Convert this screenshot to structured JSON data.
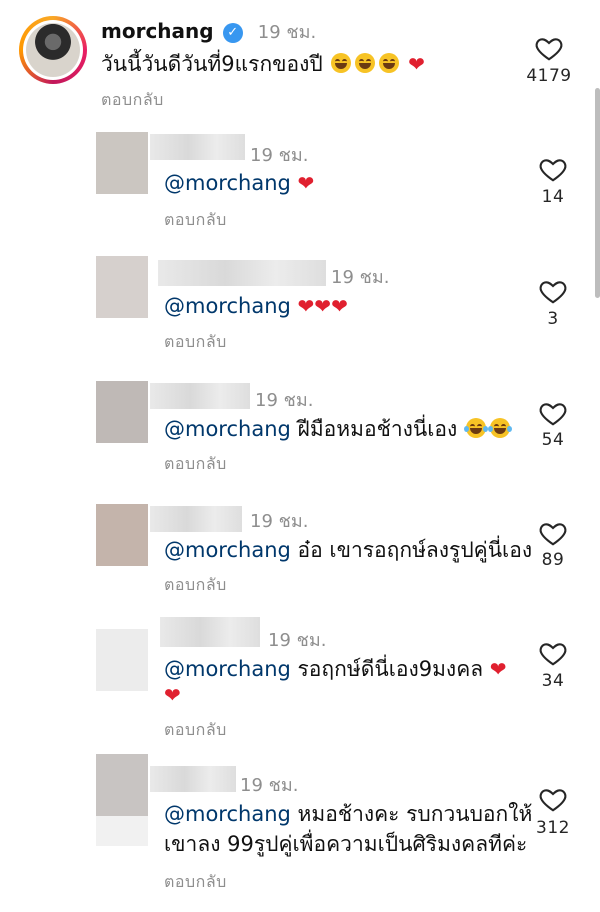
{
  "top_comment": {
    "username": "morchang",
    "time": "19 ชม.",
    "text": "วันนี้วันดีวันที่9แรกของปี",
    "reply_label": "ตอบกลับ",
    "likes": "4179"
  },
  "replies": [
    {
      "mention": "@morchang",
      "text": "",
      "hearts": 1,
      "time": "19 ชม.",
      "reply_label": "ตอบกลับ",
      "likes": "14"
    },
    {
      "mention": "@morchang",
      "text": "",
      "hearts": 3,
      "time": "19 ชม.",
      "reply_label": "ตอบกลับ",
      "likes": "3"
    },
    {
      "mention": "@morchang",
      "text": "ฝีมือหมอช้างนี่เอง",
      "hearts": 0,
      "time": "19 ชม.",
      "reply_label": "ตอบกลับ",
      "likes": "54"
    },
    {
      "mention": "@morchang",
      "text": "อ๋อ เขารอฤกษ์ลงรูปคู่นี่เอง",
      "hearts": 0,
      "time": "19 ชม.",
      "reply_label": "ตอบกลับ",
      "likes": "89"
    },
    {
      "mention": "@morchang",
      "text": "รอฤกษ์ดีนี่เอง9มงคล",
      "hearts": 2,
      "time": "19 ชม.",
      "reply_label": "ตอบกลับ",
      "likes": "34"
    },
    {
      "mention": "@morchang",
      "text": "หมอช้างคะ รบกวนบอกให้",
      "text2": "เขาลง 99รูปคู่เพื่อความเป็นศิริมงคลทีค่ะ",
      "hearts": 0,
      "time": "19 ชม.",
      "reply_label": "ตอบกลับ",
      "likes": "312"
    }
  ],
  "icons": {
    "heart": "heart-outline-icon",
    "verified": "verified-badge-icon"
  },
  "colors": {
    "mention": "#00376b",
    "verified": "#3897f0",
    "heart": "#e0202f"
  }
}
